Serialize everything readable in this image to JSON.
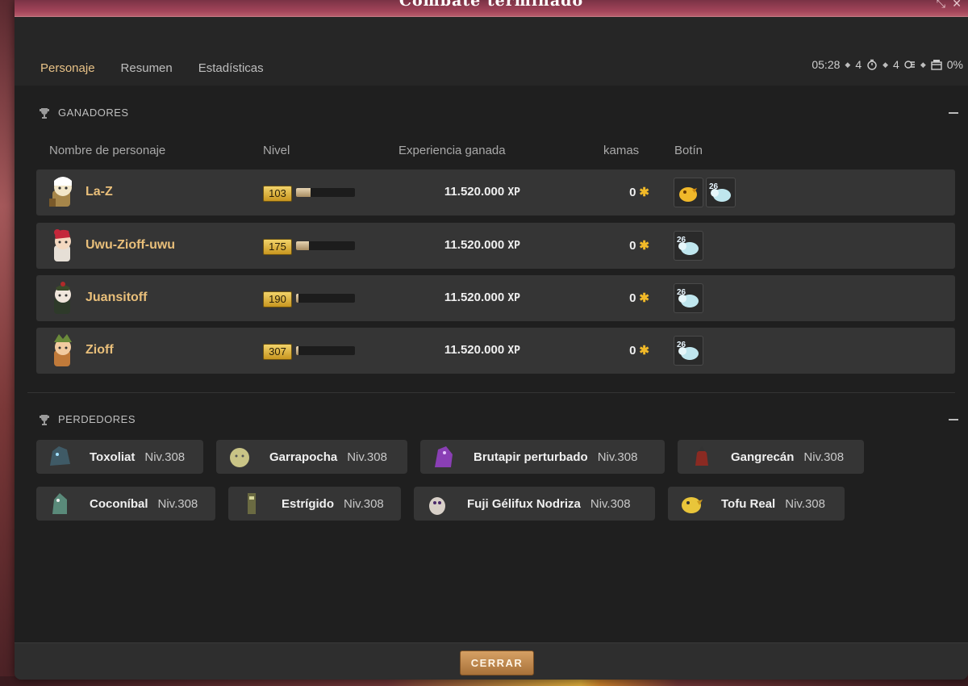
{
  "window": {
    "title": "Combate terminado"
  },
  "tabs": [
    {
      "label": "Personaje",
      "active": true
    },
    {
      "label": "Resumen",
      "active": false
    },
    {
      "label": "Estadísticas",
      "active": false
    }
  ],
  "stats": {
    "time": "05:28",
    "turns": "4",
    "fighters": "4",
    "percent": "0%"
  },
  "winners": {
    "heading": "GANADORES",
    "columns": {
      "name": "Nombre de personaje",
      "level": "Nivel",
      "xp": "Experiencia ganada",
      "kamas": "kamas",
      "loot": "Botín"
    },
    "rows": [
      {
        "name": "La-Z",
        "level": "103",
        "level_progress": 0.25,
        "xp": "11.520.000",
        "xp_unit": "XP",
        "kamas": "0",
        "loot": [
          "golden-chick-item-icon",
          "sheep-token-icon"
        ],
        "loot_badges": [
          "",
          "26"
        ]
      },
      {
        "name": "Uwu-Zioff-uwu",
        "level": "175",
        "level_progress": 0.22,
        "xp": "11.520.000",
        "xp_unit": "XP",
        "kamas": "0",
        "loot": [
          "sheep-token-icon"
        ],
        "loot_badges": [
          "26"
        ]
      },
      {
        "name": "Juansitoff",
        "level": "190",
        "level_progress": 0.04,
        "xp": "11.520.000",
        "xp_unit": "XP",
        "kamas": "0",
        "loot": [
          "sheep-token-icon"
        ],
        "loot_badges": [
          "26"
        ]
      },
      {
        "name": "Zioff",
        "level": "307",
        "level_progress": 0.02,
        "xp": "11.520.000",
        "xp_unit": "XP",
        "kamas": "0",
        "loot": [
          "sheep-token-icon"
        ],
        "loot_badges": [
          "26"
        ]
      }
    ]
  },
  "losers": {
    "heading": "PERDEDORES",
    "items": [
      {
        "name": "Toxoliat",
        "level": "Niv.308",
        "color": "#3f5a66"
      },
      {
        "name": "Garrapocha",
        "level": "Niv.308",
        "color": "#c9c486"
      },
      {
        "name": "Brutapir perturbado",
        "level": "Niv.308",
        "color": "#8a3fb5"
      },
      {
        "name": "Gangrecán",
        "level": "Niv.308",
        "color": "#8a2a22"
      },
      {
        "name": "Coconíbal",
        "level": "Niv.308",
        "color": "#5a8a7a"
      },
      {
        "name": "Estrígido",
        "level": "Niv.308",
        "color": "#6a6a42"
      },
      {
        "name": "Fuji Gélifux Nodriza",
        "level": "Niv.308",
        "color": "#d8d0c8"
      },
      {
        "name": "Tofu Real",
        "level": "Niv.308",
        "color": "#e9c53a"
      }
    ]
  },
  "footer": {
    "close_label": "CERRAR"
  },
  "colors": {
    "accent": "#e0b870",
    "name": "#e9bf7a",
    "kamas": "#f1b928",
    "button": "#c48b4e"
  }
}
